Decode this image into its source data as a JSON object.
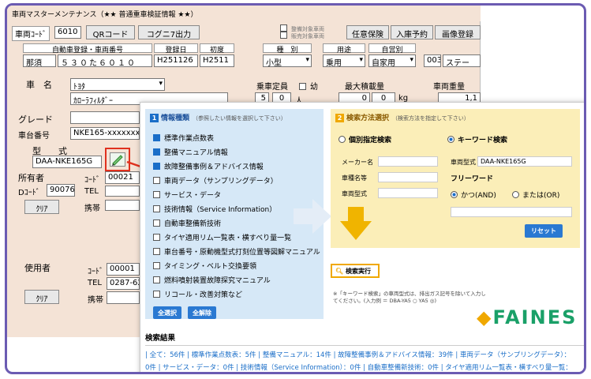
{
  "window_title": "車両マスターメンテナンス（★★ 普通重車検証情報 ★★）",
  "toolbar": {
    "vehicle_code_label": "車両ｺｰﾄﾞ",
    "vehicle_code_value": "6010",
    "qr_button": "QRコード",
    "copy_button": "コグニ7出力",
    "check1": "整備対象車両",
    "check2": "販売対象車両",
    "insurance_button": "任意保険",
    "reserve_button": "入庫予約",
    "image_button": "画像登録"
  },
  "reg": {
    "headers": [
      "自動車登録・車両番号",
      "登録日",
      "初度",
      "種　別",
      "用途",
      "自営別"
    ],
    "region": "那須",
    "number": "５３０た６０１０",
    "reg_date": "H251126",
    "first_reg": "H2511",
    "type": "小型",
    "usage": "乗用",
    "business": "自家用",
    "extra_code": "003",
    "extra_text": "ステー"
  },
  "car": {
    "name_label": "車　名",
    "maker": "ﾄﾖﾀ",
    "model_name": "ｶﾛｰﾗﾌｨﾙﾀﾞｰ",
    "capacity_label": "乗車定員",
    "child_label": "幼",
    "capacity": "5",
    "child": "0",
    "person_unit": "人",
    "max_load_label": "最大積載量",
    "max_load_a": "0",
    "max_load_b": "0",
    "kg_unit": "kg",
    "weight_label": "車両重量",
    "weight_value": "1,1"
  },
  "grade_label": "グレード",
  "chassis_label": "車台番号",
  "chassis_value": "NKE165-xxxxxxx",
  "model_label": "型　　式",
  "model_value": "DAA-NKE165G",
  "owner": {
    "label": "所有者",
    "code_label": "ｺｰﾄﾞ",
    "code_value": "00021",
    "dcode_label": "Dｺｰﾄﾞ",
    "dcode_value": "90076",
    "tel_label": "TEL",
    "mobile_label": "携帯",
    "clear_button": "ｸﾘｱ"
  },
  "user": {
    "label": "使用者",
    "code_label": "ｺｰﾄﾞ",
    "code_value": "00001",
    "tel_label": "TEL",
    "tel_value": "0287-62",
    "mobile_label": "携帯",
    "clear_button": "ｸﾘｱ"
  },
  "info": {
    "num": "1",
    "title": "情報種類",
    "note": "（参照したい情報を選択して下さい）",
    "items": [
      {
        "label": "標準作業点数表",
        "checked": true
      },
      {
        "label": "整備マニュアル情報",
        "checked": true
      },
      {
        "label": "故障整備事例＆アドバイス情報",
        "checked": true
      },
      {
        "label": "車両データ（サンプリングデータ）",
        "checked": false
      },
      {
        "label": "サービス・データ",
        "checked": false
      },
      {
        "label": "技術情報（Service Information）",
        "checked": false
      },
      {
        "label": "自動車整備新技術",
        "checked": false
      },
      {
        "label": "タイヤ適用リム一覧表・横すべり量一覧",
        "checked": false
      },
      {
        "label": "車台番号・原動機型式打刻位置等図解マニュアル",
        "checked": false
      },
      {
        "label": "タイミング・ベルト交換要領",
        "checked": false
      },
      {
        "label": "燃料噴射装置故障探究マニュアル",
        "checked": false
      },
      {
        "label": "リコール・改善対策など",
        "checked": false
      }
    ],
    "select_all": "全選択",
    "clear_all": "全解除"
  },
  "search": {
    "num": "2",
    "title": "検索方法選択",
    "note": "（検索方法を指定して下さい）",
    "individual": "個別指定検索",
    "keyword": "キーワード検索",
    "maker_label": "メーカー名",
    "car_name_label": "車種名等",
    "model_label": "車両型式",
    "model_value_label": "車両型式",
    "model_value": "DAA-NKE165G",
    "freeword": "フリーワード",
    "and": "かつ(AND)",
    "or": "または(OR)",
    "reset_button": "リセット",
    "execute_button": "検索実行",
    "footnote": "※「キーワード検索」の車両型式は、排出ガス記号を除いて入力してください。(入力例 ＝ DBA-YA5 ○ YA5 ◎)"
  },
  "logo": "FAINES",
  "results": {
    "title": "検索結果",
    "line1": "| 全て：56件 | 標準作業点数表：5件 | 整備マニュアル：14件 | 故障整備事例＆アドバイス情報：39件 | 車両データ（サンプリングデータ）：",
    "line2": "0件 | サービス・データ：0件 | 技術情報（Service Information）：0件 | 自動車整備新技術：0件 | タイヤ適用リム一覧表・横すべり量一覧："
  },
  "colors": {
    "frame": "#6b5bb2",
    "legacy_bg": "#f4e3d6",
    "info_bg": "#d6e8f7",
    "search_bg": "#fbeeb8",
    "accent_blue": "#2a79d2",
    "accent_orange": "#f0a800",
    "highlight_red": "#e0301e"
  }
}
